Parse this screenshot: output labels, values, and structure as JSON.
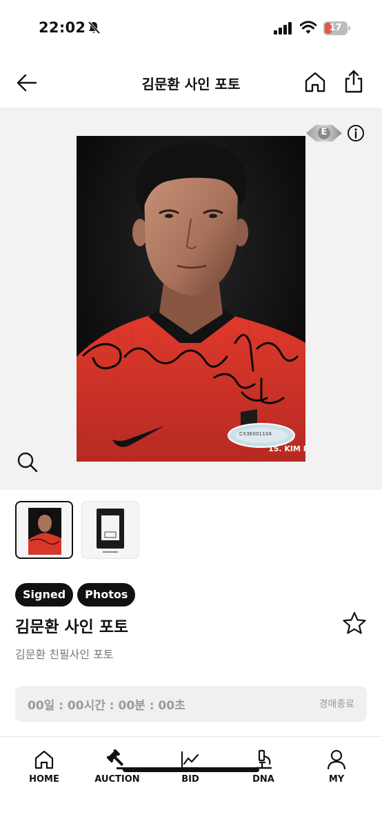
{
  "status_bar": {
    "time": "22:02",
    "battery_level": "17",
    "icons": [
      "bell-muted-icon",
      "signal-icon",
      "wifi-icon",
      "battery-icon"
    ]
  },
  "header": {
    "title": "김문환 사인 포토",
    "icons": [
      "back-arrow-icon",
      "home-icon",
      "share-icon"
    ]
  },
  "hero": {
    "grade_badge": "E",
    "photo_caption": "15. KIM M",
    "hologram_code": "CX3E001104",
    "icons": [
      "grade-diamond-icon",
      "info-icon",
      "zoom-icon"
    ]
  },
  "product": {
    "tags": [
      "Signed",
      "Photos"
    ],
    "title": "김문환 사인 포토",
    "subtitle": "김문환 친필사인 포토"
  },
  "countdown": {
    "timer": "00일 : 00시간 : 00분 : 00초",
    "status": "경매종료"
  },
  "bottom_nav": {
    "items": [
      {
        "label": "HOME",
        "icon": "home-icon"
      },
      {
        "label": "AUCTION",
        "icon": "gavel-icon"
      },
      {
        "label": "BID",
        "icon": "chart-icon"
      },
      {
        "label": "DNA",
        "icon": "microscope-icon"
      },
      {
        "label": "MY",
        "icon": "person-icon"
      }
    ]
  },
  "colors": {
    "accent": "#111111",
    "background": "#ffffff",
    "hero_bg": "#f2f2f2",
    "muted_text": "#777777",
    "jersey_red": "#d8372b"
  }
}
